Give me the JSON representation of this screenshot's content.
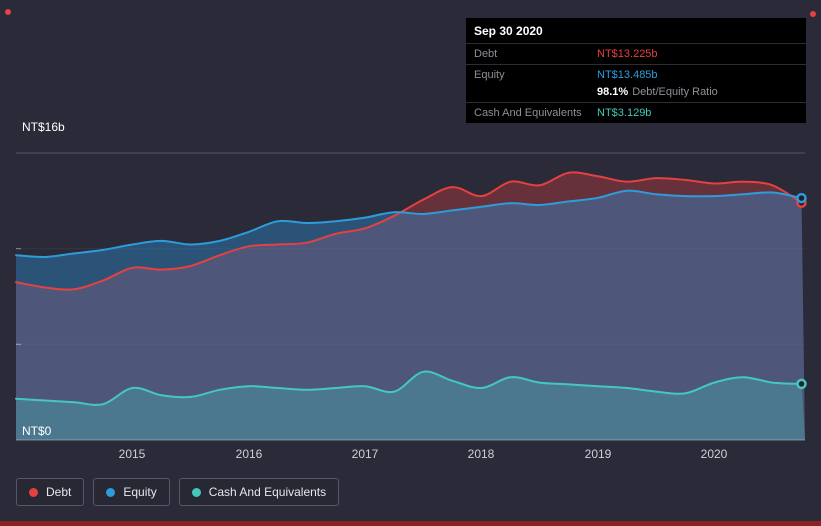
{
  "page": {
    "background": "#2a2a38",
    "bottom_bar_color": "#8a2424",
    "corner_dot_color": "#e64141"
  },
  "tooltip": {
    "date": "Sep 30 2020",
    "debt_label": "Debt",
    "debt_value": "NT$13.225b",
    "equity_label": "Equity",
    "equity_value": "NT$13.485b",
    "ratio_value": "98.1%",
    "ratio_label": "Debt/Equity Ratio",
    "cash_label": "Cash And Equivalents",
    "cash_value": "NT$3.129b"
  },
  "legend": {
    "items": [
      {
        "label": "Debt",
        "color": "#e64141"
      },
      {
        "label": "Equity",
        "color": "#2d9cdb"
      },
      {
        "label": "Cash And Equivalents",
        "color": "#45c8bc"
      }
    ]
  },
  "chart_data": {
    "type": "area",
    "title": "",
    "ylabel_top": "NT$16b",
    "ylabel_bottom": "NT$0",
    "ylim": [
      0,
      16
    ],
    "xlim": [
      2014.0,
      2020.78
    ],
    "x_ticks": [
      2015,
      2016,
      2017,
      2018,
      2019,
      2020
    ],
    "x_tick_labels": [
      "2015",
      "2016",
      "2017",
      "2018",
      "2019",
      "2020"
    ],
    "grid": "horizontal-faint",
    "legend_position": "bottom-left",
    "x": [
      2014.0,
      2014.25,
      2014.5,
      2014.75,
      2015.0,
      2015.25,
      2015.5,
      2015.75,
      2016.0,
      2016.25,
      2016.5,
      2016.75,
      2017.0,
      2017.25,
      2017.5,
      2017.75,
      2018.0,
      2018.25,
      2018.5,
      2018.75,
      2019.0,
      2019.25,
      2019.5,
      2019.75,
      2020.0,
      2020.25,
      2020.5,
      2020.75
    ],
    "series": [
      {
        "name": "Debt",
        "color": "#e64141",
        "fill": "rgba(230,65,65,0.32)",
        "values": [
          8.8,
          8.5,
          8.4,
          8.9,
          9.6,
          9.5,
          9.7,
          10.3,
          10.8,
          10.9,
          11.0,
          11.5,
          11.8,
          12.5,
          13.4,
          14.1,
          13.6,
          14.4,
          14.2,
          14.9,
          14.7,
          14.4,
          14.6,
          14.5,
          14.3,
          14.4,
          14.2,
          13.225
        ]
      },
      {
        "name": "Equity",
        "color": "#2d9cdb",
        "fill": "rgba(45,140,210,0.42)",
        "values": [
          10.3,
          10.2,
          10.4,
          10.6,
          10.9,
          11.1,
          10.9,
          11.1,
          11.6,
          12.2,
          12.1,
          12.2,
          12.4,
          12.7,
          12.6,
          12.8,
          13.0,
          13.2,
          13.1,
          13.3,
          13.5,
          13.9,
          13.7,
          13.6,
          13.6,
          13.7,
          13.8,
          13.485
        ]
      },
      {
        "name": "Cash And Equivalents",
        "color": "#45c8bc",
        "fill": "rgba(69,200,188,0.30)",
        "values": [
          2.3,
          2.2,
          2.1,
          2.0,
          2.9,
          2.5,
          2.4,
          2.8,
          3.0,
          2.9,
          2.8,
          2.9,
          3.0,
          2.7,
          3.8,
          3.3,
          2.9,
          3.5,
          3.2,
          3.1,
          3.0,
          2.9,
          2.7,
          2.6,
          3.2,
          3.5,
          3.2,
          3.129
        ]
      }
    ]
  }
}
